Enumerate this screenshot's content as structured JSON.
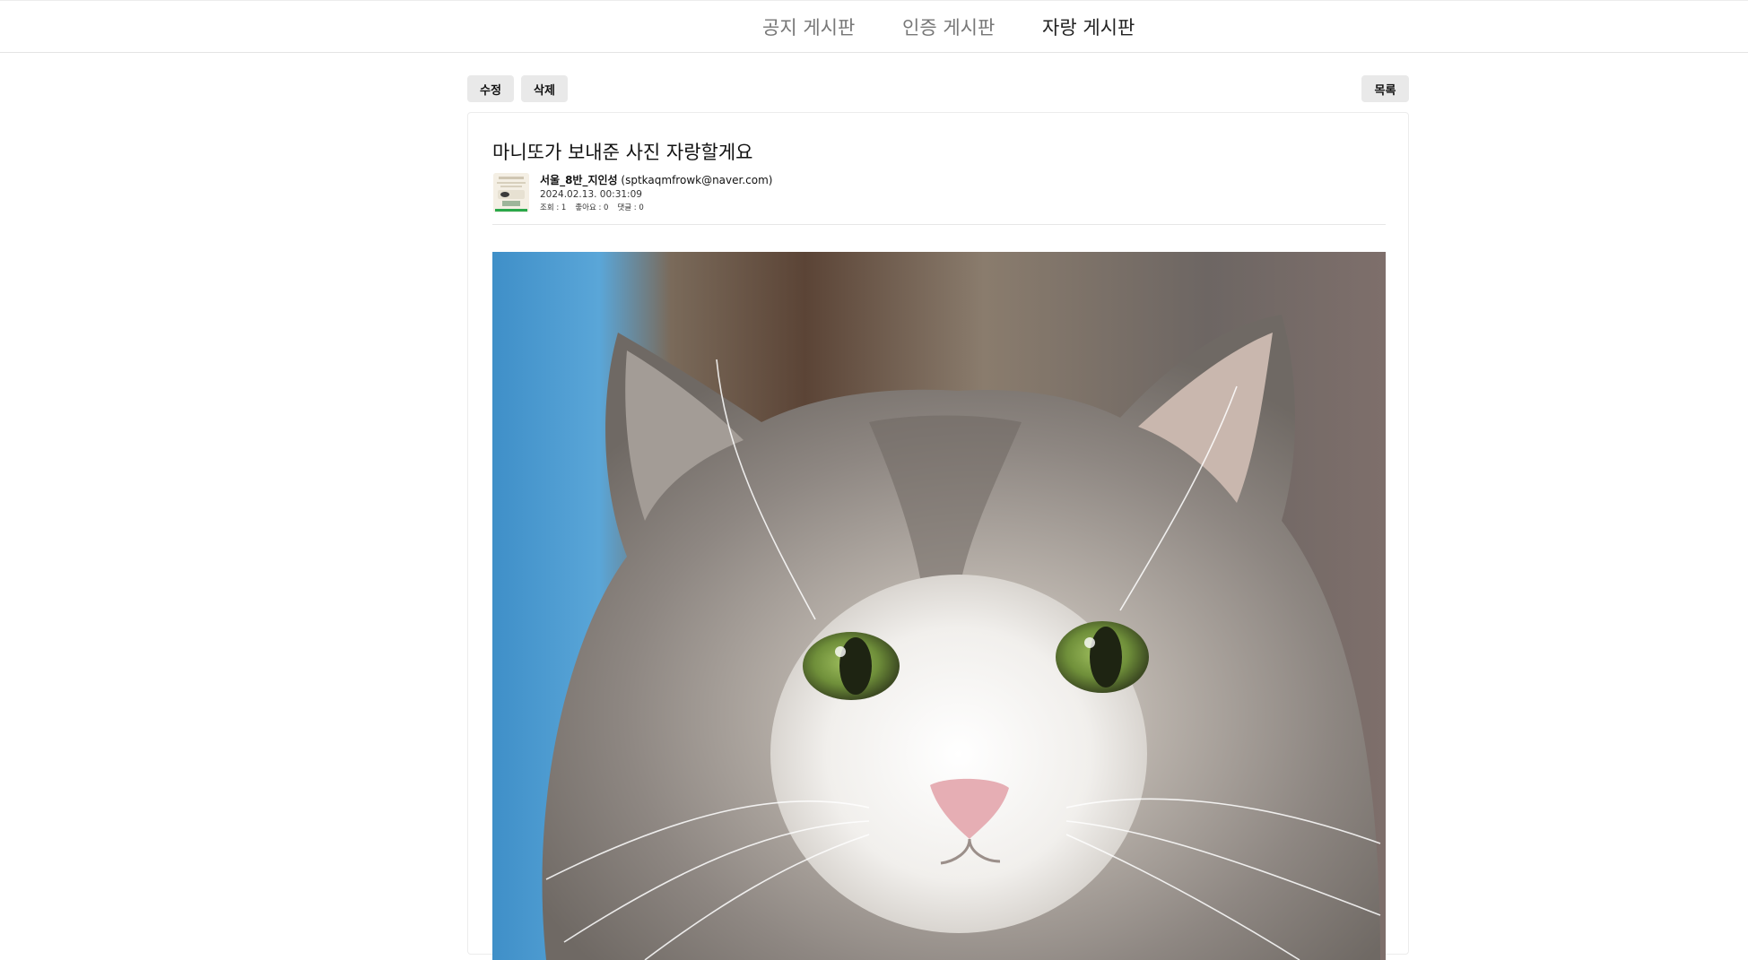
{
  "nav": {
    "items": [
      {
        "label": "공지 게시판"
      },
      {
        "label": "인증 게시판"
      },
      {
        "label": "자랑 게시판"
      }
    ]
  },
  "toolbar": {
    "edit_label": "수정",
    "delete_label": "삭제",
    "list_label": "목록"
  },
  "post": {
    "title": "마니또가 보내준 사진 자랑할게요",
    "author_name": "서울_8반_지인성",
    "author_email": "(sptkaqmfrowk@naver.com)",
    "date": "2024.02.13. 00:31:09",
    "stats": {
      "views": "조회 : 1",
      "likes": "좋아요 : 0",
      "comments": "댓글 : 0"
    }
  },
  "colors": {
    "nav_active": "#222222",
    "nav_inactive": "#777777",
    "button_bg": "#e9e9e9"
  }
}
